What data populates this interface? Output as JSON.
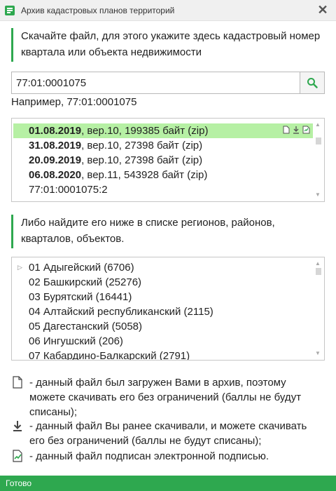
{
  "window": {
    "title": "Архив кадастровых планов территорий",
    "close_glyph": "✕"
  },
  "instructions": {
    "top": "Скачайте файл, для этого укажите здесь кадастровый номер квартала или объекта недвижимости",
    "middle": "Либо найдите его ниже в списке регионов, районов, кварталов, объектов."
  },
  "search": {
    "value": "77:01:0001075",
    "example": "Например, 77:01:0001075"
  },
  "files": [
    {
      "date": "01.08.2019",
      "rest": ", вер.10, 199385 байт (zip)",
      "highlighted": true
    },
    {
      "date": "31.08.2019",
      "rest": ", вер.10, 27398 байт (zip)",
      "highlighted": false
    },
    {
      "date": "20.09.2019",
      "rest": ", вер.10, 27398 байт (zip)",
      "highlighted": false
    },
    {
      "date": "06.08.2020",
      "rest": ", вер.11, 543928 байт (zip)",
      "highlighted": false
    },
    {
      "date": "",
      "rest": "77:01:0001075:2",
      "highlighted": false
    }
  ],
  "regions": [
    "01 Адыгейский (6706)",
    "02 Башкирский (25276)",
    "03 Бурятский (16441)",
    "04 Алтайский республиканский (2115)",
    "05 Дагестанский (5058)",
    "06 Ингушский (206)",
    "07 Кабардино-Балкарский (2791)"
  ],
  "legend": [
    {
      "icon": "document-icon",
      "text": "- данный файл был загружен Вами в архив, поэтому можете скачивать его без ограничений (баллы не будут списаны);"
    },
    {
      "icon": "download-icon",
      "text": "- данный файл Вы ранее скачивали, и можете скачивать его без ограничений (баллы не будут списаны);"
    },
    {
      "icon": "signature-icon",
      "text": "- данный файл подписан электронной подписью."
    }
  ],
  "status": "Готово",
  "colors": {
    "accent": "#2ea84f",
    "highlight": "#b6f0a4"
  }
}
